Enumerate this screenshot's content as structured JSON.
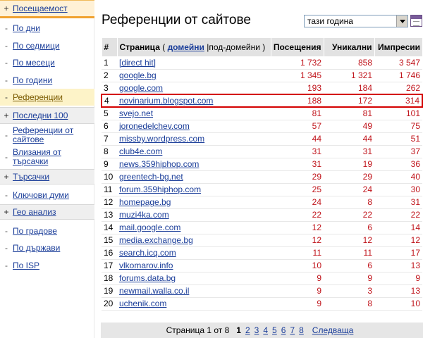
{
  "sidebar": {
    "items": [
      {
        "label": "Посещаемост",
        "mark": "+",
        "kind": "active-head"
      },
      {
        "label": "По дни",
        "mark": "-",
        "kind": "sub"
      },
      {
        "label": "По седмици",
        "mark": "-",
        "kind": "sub"
      },
      {
        "label": "По месеци",
        "mark": "-",
        "kind": "sub"
      },
      {
        "label": "По години",
        "mark": "-",
        "kind": "sub"
      },
      {
        "label": "Референции",
        "mark": "-",
        "kind": "active-sub"
      },
      {
        "label": "Последни 100",
        "mark": "+",
        "kind": "head"
      },
      {
        "label": "Референции от сайтове",
        "mark": "-",
        "kind": "sub"
      },
      {
        "label": "Влизания от търсачки",
        "mark": "-",
        "kind": "sub"
      },
      {
        "label": "Търсачки",
        "mark": "+",
        "kind": "head"
      },
      {
        "label": "Ключови думи",
        "mark": "-",
        "kind": "sub"
      },
      {
        "label": "Гео анализ",
        "mark": "+",
        "kind": "head"
      },
      {
        "label": "По градове",
        "mark": "-",
        "kind": "sub"
      },
      {
        "label": "По държави",
        "mark": "-",
        "kind": "sub"
      },
      {
        "label": "По ISP",
        "mark": "-",
        "kind": "sub"
      }
    ]
  },
  "header": {
    "title": "Референции от сайтове",
    "period": "тази година"
  },
  "table": {
    "col_index": "#",
    "col_page": "Страница",
    "col_page_open": "(",
    "col_domains_link": "домейни",
    "col_sep": "|",
    "col_subdomains": "под-домейни",
    "col_page_close": ")",
    "col_visits": "Посещения",
    "col_uniques": "Уникални",
    "col_impressions": "Импресии",
    "rows": [
      {
        "n": "1",
        "page": "[direct hit]",
        "visits": "1 732",
        "uniques": "858",
        "impressions": "3 547"
      },
      {
        "n": "2",
        "page": "google.bg",
        "visits": "1 345",
        "uniques": "1 321",
        "impressions": "1 746"
      },
      {
        "n": "3",
        "page": "google.com",
        "visits": "193",
        "uniques": "184",
        "impressions": "262"
      },
      {
        "n": "4",
        "page": "novinarium.blogspot.com",
        "visits": "188",
        "uniques": "172",
        "impressions": "314",
        "highlight": true
      },
      {
        "n": "5",
        "page": "svejo.net",
        "visits": "81",
        "uniques": "81",
        "impressions": "101"
      },
      {
        "n": "6",
        "page": "joronedelchev.com",
        "visits": "57",
        "uniques": "49",
        "impressions": "75"
      },
      {
        "n": "7",
        "page": "missby.wordpress.com",
        "visits": "44",
        "uniques": "44",
        "impressions": "51"
      },
      {
        "n": "8",
        "page": "club4e.com",
        "visits": "31",
        "uniques": "31",
        "impressions": "37"
      },
      {
        "n": "9",
        "page": "news.359hiphop.com",
        "visits": "31",
        "uniques": "19",
        "impressions": "36"
      },
      {
        "n": "10",
        "page": "greentech-bg.net",
        "visits": "29",
        "uniques": "29",
        "impressions": "40"
      },
      {
        "n": "11",
        "page": "forum.359hiphop.com",
        "visits": "25",
        "uniques": "24",
        "impressions": "30"
      },
      {
        "n": "12",
        "page": "homepage.bg",
        "visits": "24",
        "uniques": "8",
        "impressions": "31"
      },
      {
        "n": "13",
        "page": "muzi4ka.com",
        "visits": "22",
        "uniques": "22",
        "impressions": "22"
      },
      {
        "n": "14",
        "page": "mail.google.com",
        "visits": "12",
        "uniques": "6",
        "impressions": "14"
      },
      {
        "n": "15",
        "page": "media.exchange.bg",
        "visits": "12",
        "uniques": "12",
        "impressions": "12"
      },
      {
        "n": "16",
        "page": "search.icq.com",
        "visits": "11",
        "uniques": "11",
        "impressions": "17"
      },
      {
        "n": "17",
        "page": "vlkomarov.info",
        "visits": "10",
        "uniques": "6",
        "impressions": "13"
      },
      {
        "n": "18",
        "page": "forums.data.bg",
        "visits": "9",
        "uniques": "9",
        "impressions": "9"
      },
      {
        "n": "19",
        "page": "newmail.walla.co.il",
        "visits": "9",
        "uniques": "3",
        "impressions": "13"
      },
      {
        "n": "20",
        "page": "uchenik.com",
        "visits": "9",
        "uniques": "8",
        "impressions": "10"
      }
    ]
  },
  "pager": {
    "info": "Страница 1 от 8",
    "current": "1",
    "pages": [
      "2",
      "3",
      "4",
      "5",
      "6",
      "7",
      "8"
    ],
    "next": "Следваща"
  }
}
